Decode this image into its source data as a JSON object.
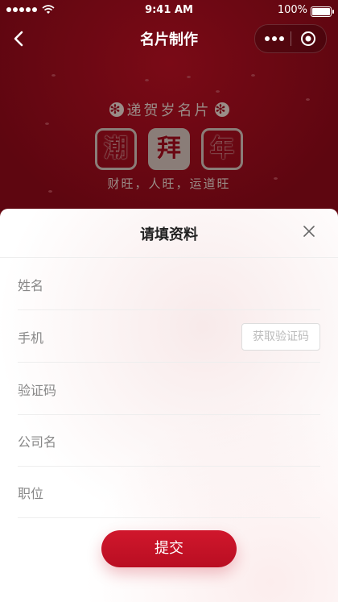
{
  "status_bar": {
    "time": "9:41 AM",
    "battery": "100%"
  },
  "navbar": {
    "title": "名片制作"
  },
  "banner": {
    "subtitle": "递贺岁名片",
    "tiles": [
      "潮",
      "拜",
      "年"
    ],
    "wish": "财旺，人旺，运道旺"
  },
  "sheet": {
    "title": "请填资料",
    "fields": [
      {
        "label": "姓名"
      },
      {
        "label": "手机",
        "action": "获取验证码"
      },
      {
        "label": "验证码"
      },
      {
        "label": "公司名"
      },
      {
        "label": "职位"
      }
    ],
    "submit": "提交"
  },
  "colors": {
    "accent": "#c8102e",
    "header_bg": "#6a0712"
  }
}
